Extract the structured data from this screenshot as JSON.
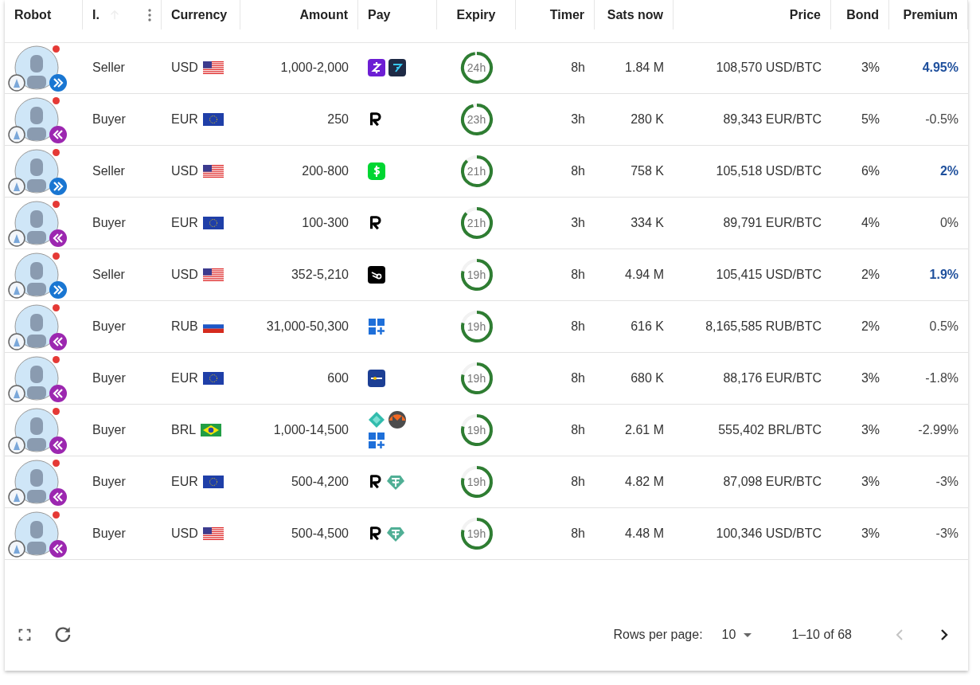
{
  "columns": [
    {
      "label": "Robot"
    },
    {
      "label": "I.",
      "menu": true
    },
    {
      "label": "Currency"
    },
    {
      "label": "Amount"
    },
    {
      "label": "Pay"
    },
    {
      "label": "Expiry"
    },
    {
      "label": "Timer"
    },
    {
      "label": "Sats now"
    },
    {
      "label": "Price"
    },
    {
      "label": "Bond"
    },
    {
      "label": "Premium"
    }
  ],
  "rows": [
    {
      "side": "Seller",
      "kind": "sell",
      "currency": "USD",
      "flag": {
        "kind": "us"
      },
      "amount": "1,000-2,000",
      "pay": [
        {
          "kind": "zelle"
        },
        {
          "kind": "wise"
        }
      ],
      "expiry": {
        "text": "24h",
        "level": 0.98
      },
      "timer": "8h",
      "sats": "1.84 M",
      "price": "108,570 USD/BTC",
      "bond": "3%",
      "premium": "4.95%",
      "highlight": true
    },
    {
      "side": "Buyer",
      "kind": "buy",
      "currency": "EUR",
      "flag": {
        "kind": "eu"
      },
      "amount": "250",
      "pay": [
        {
          "kind": "revolut"
        }
      ],
      "expiry": {
        "text": "23h",
        "level": 0.96
      },
      "timer": "3h",
      "sats": "280 K",
      "price": "89,343 EUR/BTC",
      "bond": "5%",
      "premium": "-0.5%",
      "highlight": false
    },
    {
      "side": "Seller",
      "kind": "sell",
      "currency": "USD",
      "flag": {
        "kind": "us"
      },
      "amount": "200-800",
      "pay": [
        {
          "kind": "cashapp"
        }
      ],
      "expiry": {
        "text": "21h",
        "level": 0.88
      },
      "timer": "8h",
      "sats": "758 K",
      "price": "105,518 USD/BTC",
      "bond": "6%",
      "premium": "2%",
      "highlight": true
    },
    {
      "side": "Buyer",
      "kind": "buy",
      "currency": "EUR",
      "flag": {
        "kind": "eu"
      },
      "amount": "100-300",
      "pay": [
        {
          "kind": "revolut"
        }
      ],
      "expiry": {
        "text": "21h",
        "level": 0.87
      },
      "timer": "3h",
      "sats": "334 K",
      "price": "89,791 EUR/BTC",
      "bond": "4%",
      "premium": "0%",
      "highlight": false
    },
    {
      "side": "Seller",
      "kind": "sell",
      "currency": "USD",
      "flag": {
        "kind": "us"
      },
      "amount": "352-5,210",
      "pay": [
        {
          "kind": "comet"
        }
      ],
      "expiry": {
        "text": "19h",
        "level": 0.79
      },
      "timer": "8h",
      "sats": "4.94 M",
      "price": "105,415 USD/BTC",
      "bond": "2%",
      "premium": "1.9%",
      "highlight": true
    },
    {
      "side": "Buyer",
      "kind": "buy",
      "currency": "RUB",
      "flag": {
        "kind": "ru"
      },
      "amount": "31,000-50,300",
      "pay": [
        {
          "kind": "instant"
        }
      ],
      "expiry": {
        "text": "19h",
        "level": 0.79
      },
      "timer": "8h",
      "sats": "616 K",
      "price": "8,165,585 RUB/BTC",
      "bond": "2%",
      "premium": "0.5%",
      "highlight": false
    },
    {
      "side": "Buyer",
      "kind": "buy",
      "currency": "EUR",
      "flag": {
        "kind": "eu"
      },
      "amount": "600",
      "pay": [
        {
          "kind": "sepa"
        }
      ],
      "expiry": {
        "text": "19h",
        "level": 0.79
      },
      "timer": "8h",
      "sats": "680 K",
      "price": "88,176 EUR/BTC",
      "bond": "3%",
      "premium": "-1.8%",
      "highlight": false
    },
    {
      "side": "Buyer",
      "kind": "buy",
      "currency": "BRL",
      "flag": {
        "kind": "br"
      },
      "amount": "1,000-14,500",
      "pay": [
        {
          "kind": "pix"
        },
        {
          "kind": "monero"
        },
        {
          "kind": "instant"
        }
      ],
      "expiry": {
        "text": "19h",
        "level": 0.79
      },
      "timer": "8h",
      "sats": "2.61 M",
      "price": "555,402 BRL/BTC",
      "bond": "3%",
      "premium": "-2.99%",
      "highlight": false
    },
    {
      "side": "Buyer",
      "kind": "buy",
      "currency": "EUR",
      "flag": {
        "kind": "eu"
      },
      "amount": "500-4,200",
      "pay": [
        {
          "kind": "revolut"
        },
        {
          "kind": "tether"
        }
      ],
      "expiry": {
        "text": "19h",
        "level": 0.79
      },
      "timer": "8h",
      "sats": "4.82 M",
      "price": "87,098 EUR/BTC",
      "bond": "3%",
      "premium": "-3%",
      "highlight": false
    },
    {
      "side": "Buyer",
      "kind": "buy",
      "currency": "USD",
      "flag": {
        "kind": "us"
      },
      "amount": "500-4,500",
      "pay": [
        {
          "kind": "revolut"
        },
        {
          "kind": "tether"
        }
      ],
      "expiry": {
        "text": "19h",
        "level": 0.79
      },
      "timer": "8h",
      "sats": "4.48 M",
      "price": "100,346 USD/BTC",
      "bond": "3%",
      "premium": "-3%",
      "highlight": false
    }
  ],
  "footer": {
    "rows_per_page_label": "Rows per page:",
    "rows_per_page": "10",
    "range": "1–10 of 68",
    "prev_disabled": true,
    "next_disabled": false
  }
}
